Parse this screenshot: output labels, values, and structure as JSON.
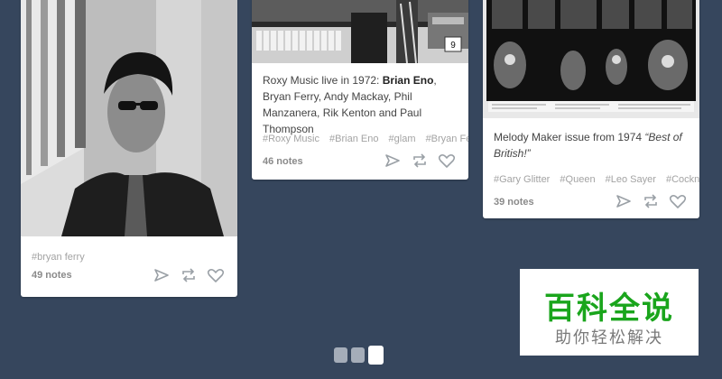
{
  "posts": [
    {
      "tags": [
        "#bryan ferry"
      ],
      "notes": "49 notes"
    },
    {
      "badge": "9",
      "caption_prefix": "Roxy Music live in 1972: ",
      "caption_bold": "Brian Eno",
      "caption_rest": ", Bryan Ferry, Andy Mackay, Phil Manzanera, Rik Kenton and Paul Thompson",
      "tags": [
        "#Roxy Music",
        "#Brian Eno",
        "#glam",
        "#Bryan Ferry"
      ],
      "notes": "46 notes"
    },
    {
      "caption_prefix": "Melody Maker issue from 1974 ",
      "caption_italic": "“Best of British!”",
      "tags": [
        "#Gary Glitter",
        "#Queen",
        "#Leo Sayer",
        "#Cockney Rebel"
      ],
      "notes": "39 notes"
    }
  ],
  "icons": [
    "send-icon",
    "reblog-icon",
    "heart-icon"
  ],
  "watermark": {
    "title": "百科全说",
    "subtitle": "助你轻松解决"
  },
  "pager": {
    "count": 3,
    "active": 2
  },
  "colors": {
    "background": "#36465d",
    "watermark_green": "#1aa51c"
  }
}
